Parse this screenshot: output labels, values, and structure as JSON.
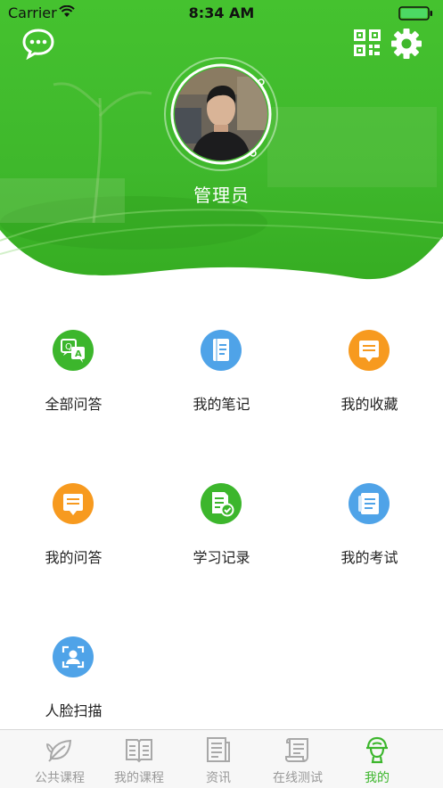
{
  "status_bar": {
    "carrier": "Carrier",
    "time": "8:34 AM"
  },
  "colors": {
    "accent": "#3cb62c",
    "tab_inactive": "#999999"
  },
  "header": {
    "left_icon": "chat-bubble-icon",
    "right_icons": [
      "qr-code-icon",
      "gear-icon"
    ],
    "username": "管理员"
  },
  "menu": [
    {
      "label": "全部问答",
      "icon": "qa-translate-icon",
      "color": "#3cb62c"
    },
    {
      "label": "我的笔记",
      "icon": "notebook-icon",
      "color": "#4fa3e8"
    },
    {
      "label": "我的收藏",
      "icon": "favorite-note-icon",
      "color": "#f79a1f"
    },
    {
      "label": "我的问答",
      "icon": "my-qa-icon",
      "color": "#f79a1f"
    },
    {
      "label": "学习记录",
      "icon": "study-record-icon",
      "color": "#3cb62c"
    },
    {
      "label": "我的考试",
      "icon": "exam-icon",
      "color": "#4fa3e8"
    },
    {
      "label": "人脸扫描",
      "icon": "face-scan-icon",
      "color": "#4fa3e8"
    }
  ],
  "tabbar": [
    {
      "label": "公共课程",
      "icon": "leaf-icon",
      "active": false
    },
    {
      "label": "我的课程",
      "icon": "open-book-icon",
      "active": false
    },
    {
      "label": "资讯",
      "icon": "news-icon",
      "active": false
    },
    {
      "label": "在线测试",
      "icon": "scroll-icon",
      "active": false
    },
    {
      "label": "我的",
      "icon": "person-icon",
      "active": true
    }
  ]
}
